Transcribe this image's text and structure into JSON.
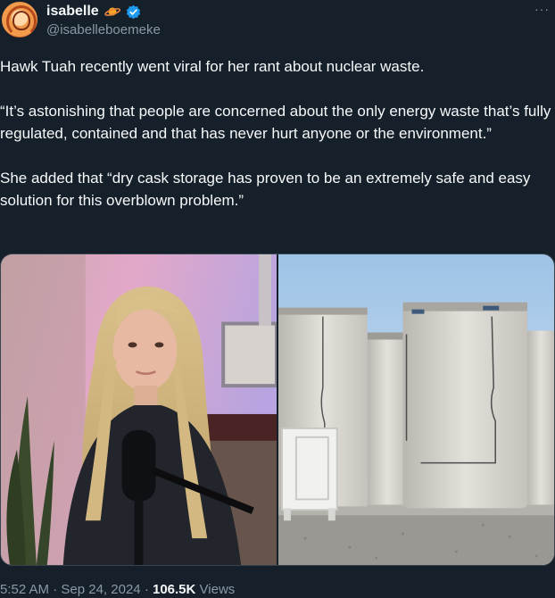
{
  "author": {
    "display_name": "isabelle",
    "handle": "@isabelleboemeke",
    "name_emoji_icon": "ringed-planet-icon",
    "verified_icon": "verified-badge-icon"
  },
  "tweet": {
    "paragraphs": [
      "Hawk Tuah recently went viral for her rant about nuclear waste.",
      "“It’s astonishing that people are concerned about the only energy waste that’s fully regulated, contained and that has never hurt anyone or the environment.”",
      "She added that “dry cask storage has proven to be an extremely safe and easy solution for this overblown problem.”"
    ],
    "more_icon": "more-options-icon"
  },
  "media": {
    "images": [
      {
        "icon": "podcast-woman-photo"
      },
      {
        "icon": "dry-cask-storage-photo"
      }
    ]
  },
  "meta": {
    "time": "5:52 AM",
    "separator": "·",
    "date": "Sep 24, 2024",
    "views_count": "106.5K",
    "views_label": "Views"
  },
  "colors": {
    "background": "#15202b",
    "text": "#f7f9f9",
    "secondary_text": "#8b98a5",
    "verified": "#1d9bf0"
  }
}
